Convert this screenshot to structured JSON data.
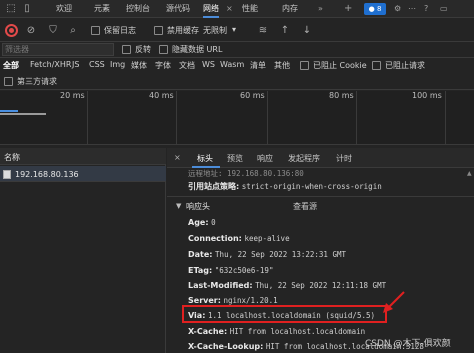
{
  "tabbar": {
    "tabs": [
      "欢迎",
      "元素",
      "控制台",
      "源代码",
      "网络",
      "性能",
      "内存"
    ],
    "badge_count": "8"
  },
  "toolbar": {
    "preserve_log": "保留日志",
    "disable_cache": "禁用缓存",
    "throttle": "无限制"
  },
  "filter": {
    "placeholder": "筛选器",
    "invert": "反转",
    "hide_data_urls": "隐藏数据 URL"
  },
  "types": [
    "全部",
    "Fetch/XHR",
    "JS",
    "CSS",
    "Img",
    "媒体",
    "字体",
    "文档",
    "WS",
    "Wasm",
    "清单",
    "其他"
  ],
  "blocked_cookies": "已阻止 Cookie",
  "blocked_requests": "已阻止请求",
  "third_party": "第三方请求",
  "timeline": {
    "ticks": [
      "20 ms",
      "40 ms",
      "60 ms",
      "80 ms",
      "100 ms"
    ]
  },
  "list": {
    "column": "名称",
    "request": "192.168.80.136"
  },
  "details": {
    "tabs": [
      "标头",
      "预览",
      "响应",
      "发起程序",
      "计时"
    ],
    "truncated_line": "远程地址:    192.168.80.136:80",
    "referrer_key": "引用站点策略:",
    "referrer_val": "strict-origin-when-cross-origin",
    "section_title": "响应头",
    "view_source": "查看源",
    "headers": [
      {
        "k": "Age:",
        "v": "0"
      },
      {
        "k": "Connection:",
        "v": "keep-alive"
      },
      {
        "k": "Date:",
        "v": "Thu, 22 Sep 2022 13:22:31 GMT"
      },
      {
        "k": "ETag:",
        "v": "\"632c50e6-19\""
      },
      {
        "k": "Last-Modified:",
        "v": "Thu, 22 Sep 2022 12:11:18 GMT"
      },
      {
        "k": "Server:",
        "v": "nginx/1.20.1"
      },
      {
        "k": "Via:",
        "v": "1.1 localhost.localdomain (squid/5.5)"
      },
      {
        "k": "X-Cache:",
        "v": "HIT from localhost.localdomain"
      },
      {
        "k": "X-Cache-Lookup:",
        "v": "HIT from localhost.localdomain:3128"
      }
    ]
  },
  "watermark": "CSDN @木下-俱欢颜",
  "colors": {
    "accent": "#4c8cd8",
    "record": "#e24a4a",
    "highlight": "#e02020"
  }
}
